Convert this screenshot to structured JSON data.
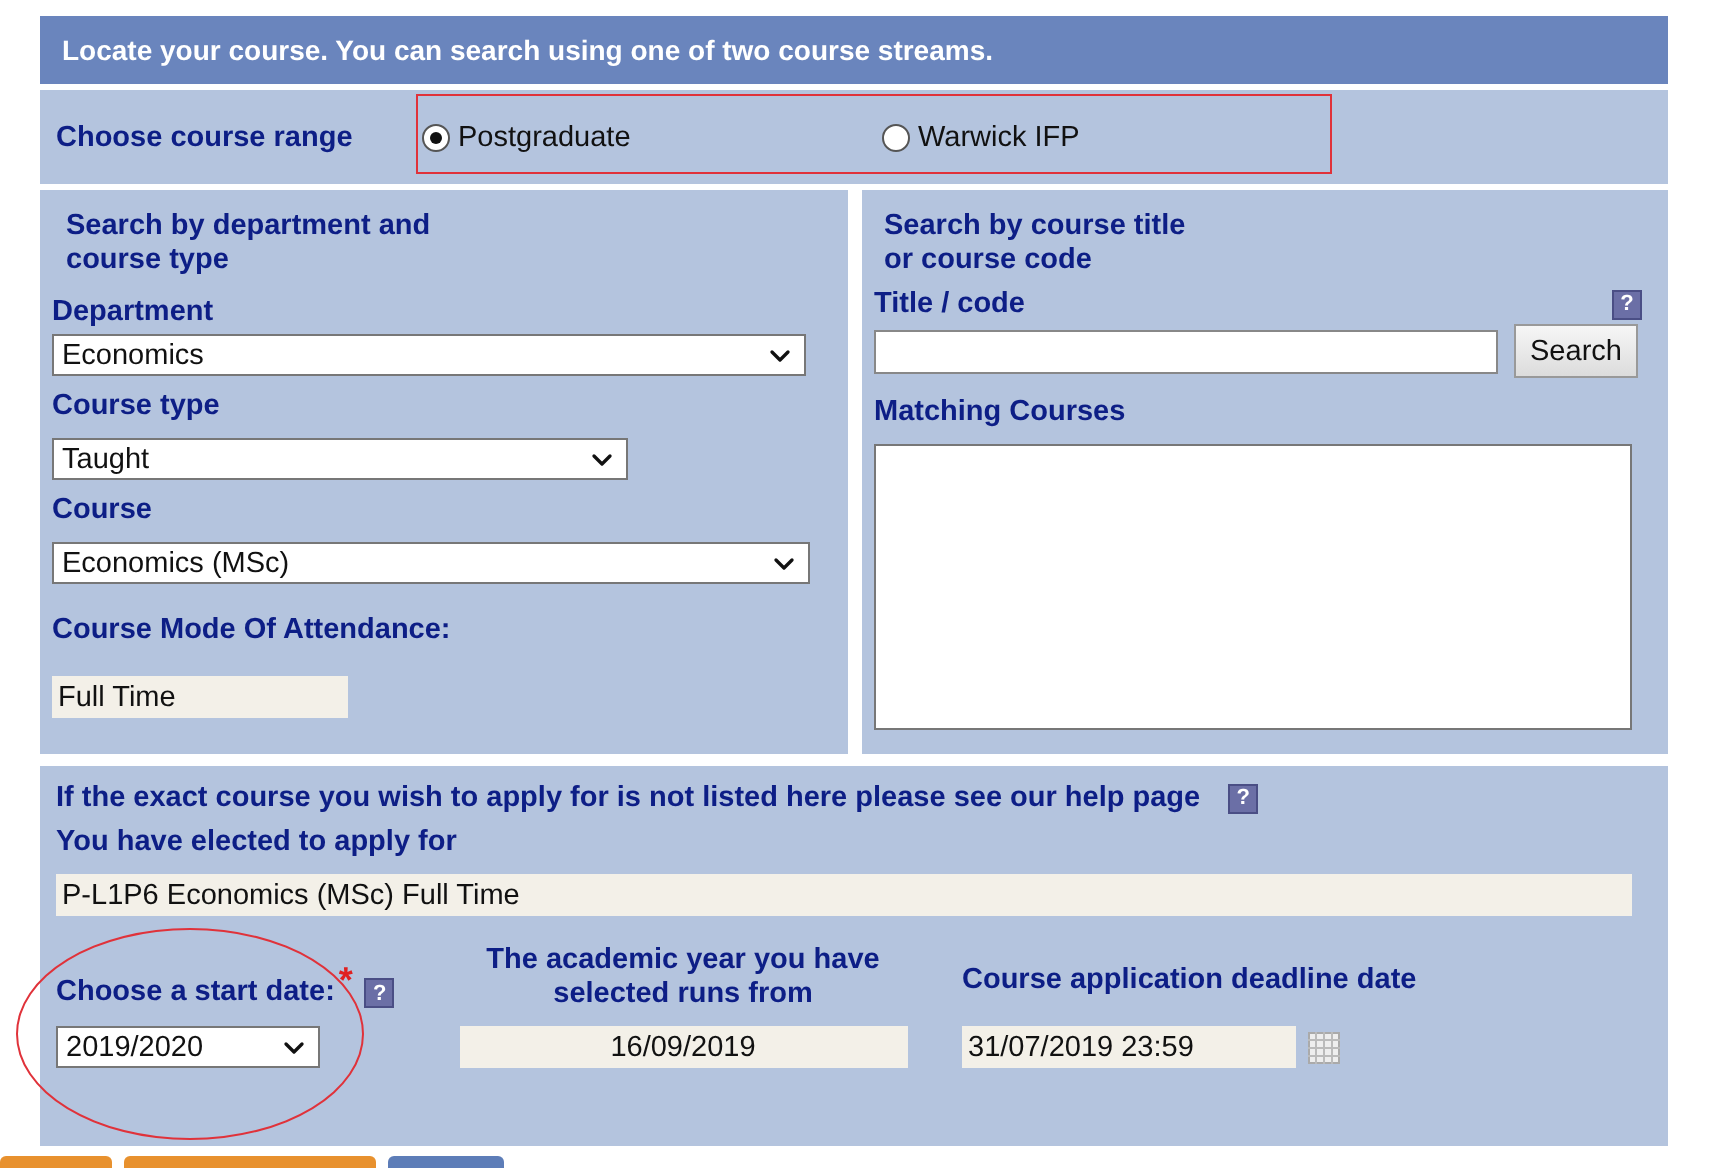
{
  "header": {
    "title": "Locate your course. You can search using one of two course streams."
  },
  "course_range": {
    "label": "Choose course range",
    "options": [
      {
        "label": "Postgraduate",
        "selected": true
      },
      {
        "label": "Warwick IFP",
        "selected": false
      }
    ]
  },
  "department_search": {
    "heading": "Search by department and course type",
    "fields": [
      {
        "label": "Department",
        "value": "Economics"
      },
      {
        "label": "Course type",
        "value": "Taught"
      },
      {
        "label": "Course",
        "value": "Economics (MSc)"
      }
    ],
    "mode": {
      "label": "Course Mode Of Attendance:",
      "value": "Full Time"
    }
  },
  "title_search": {
    "heading": "Search by course title or course code",
    "label": "Title / code",
    "help": "?",
    "button": "Search",
    "results_label": "Matching Courses"
  },
  "selection": {
    "help_text": "If the exact course you wish to apply for is not listed here please see our help page",
    "help": "?",
    "elected_label": "You have elected to apply for",
    "elected_value": "P-L1P6 Economics (MSc) Full Time",
    "start_date": {
      "label": "Choose a start date:",
      "required": "*",
      "help": "?",
      "value": "2019/2020"
    },
    "year": {
      "label": "The academic year you have selected runs from",
      "value": "16/09/2019"
    },
    "deadline": {
      "label": "Course application deadline date",
      "value": "31/07/2019 23:59"
    }
  }
}
